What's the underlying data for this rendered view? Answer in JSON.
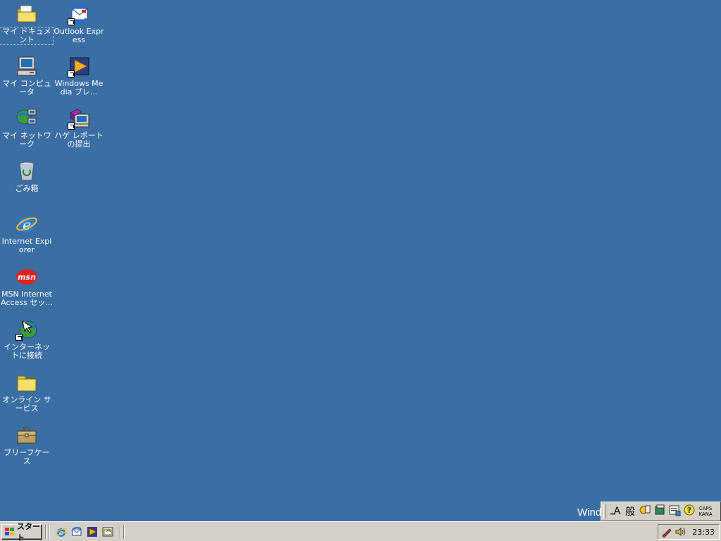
{
  "desktop": {
    "icons": [
      {
        "label": "マイ ドキュメント"
      },
      {
        "label": "Outlook Express"
      },
      {
        "label": "マイ コンピュータ"
      },
      {
        "label": "Windows Media プレ..."
      },
      {
        "label": "マイ ネットワーク"
      },
      {
        "label": "ハゲ レポートの提出"
      },
      {
        "label": "ごみ箱"
      },
      {
        "label": "Internet Explorer"
      },
      {
        "label": "MSN Internet Access セッ..."
      },
      {
        "label": "インターネットに接続"
      },
      {
        "label": "オンライン サービス"
      },
      {
        "label": "ブリーフケース"
      }
    ],
    "watermark": "Windo",
    "background_color": "#3a6ea5"
  },
  "ime_toolbar": {
    "mode_label": "A",
    "conversion_label": "般",
    "caps_label": "CAPS",
    "kana_label": "KANA"
  },
  "taskbar": {
    "start_label": "スタート",
    "quick_launch": [
      "internet-explorer-icon",
      "outlook-express-icon",
      "windows-media-player-icon",
      "show-desktop-icon"
    ],
    "tray_icons": [
      "pen-icon",
      "volume-icon"
    ],
    "clock": "23:33"
  }
}
